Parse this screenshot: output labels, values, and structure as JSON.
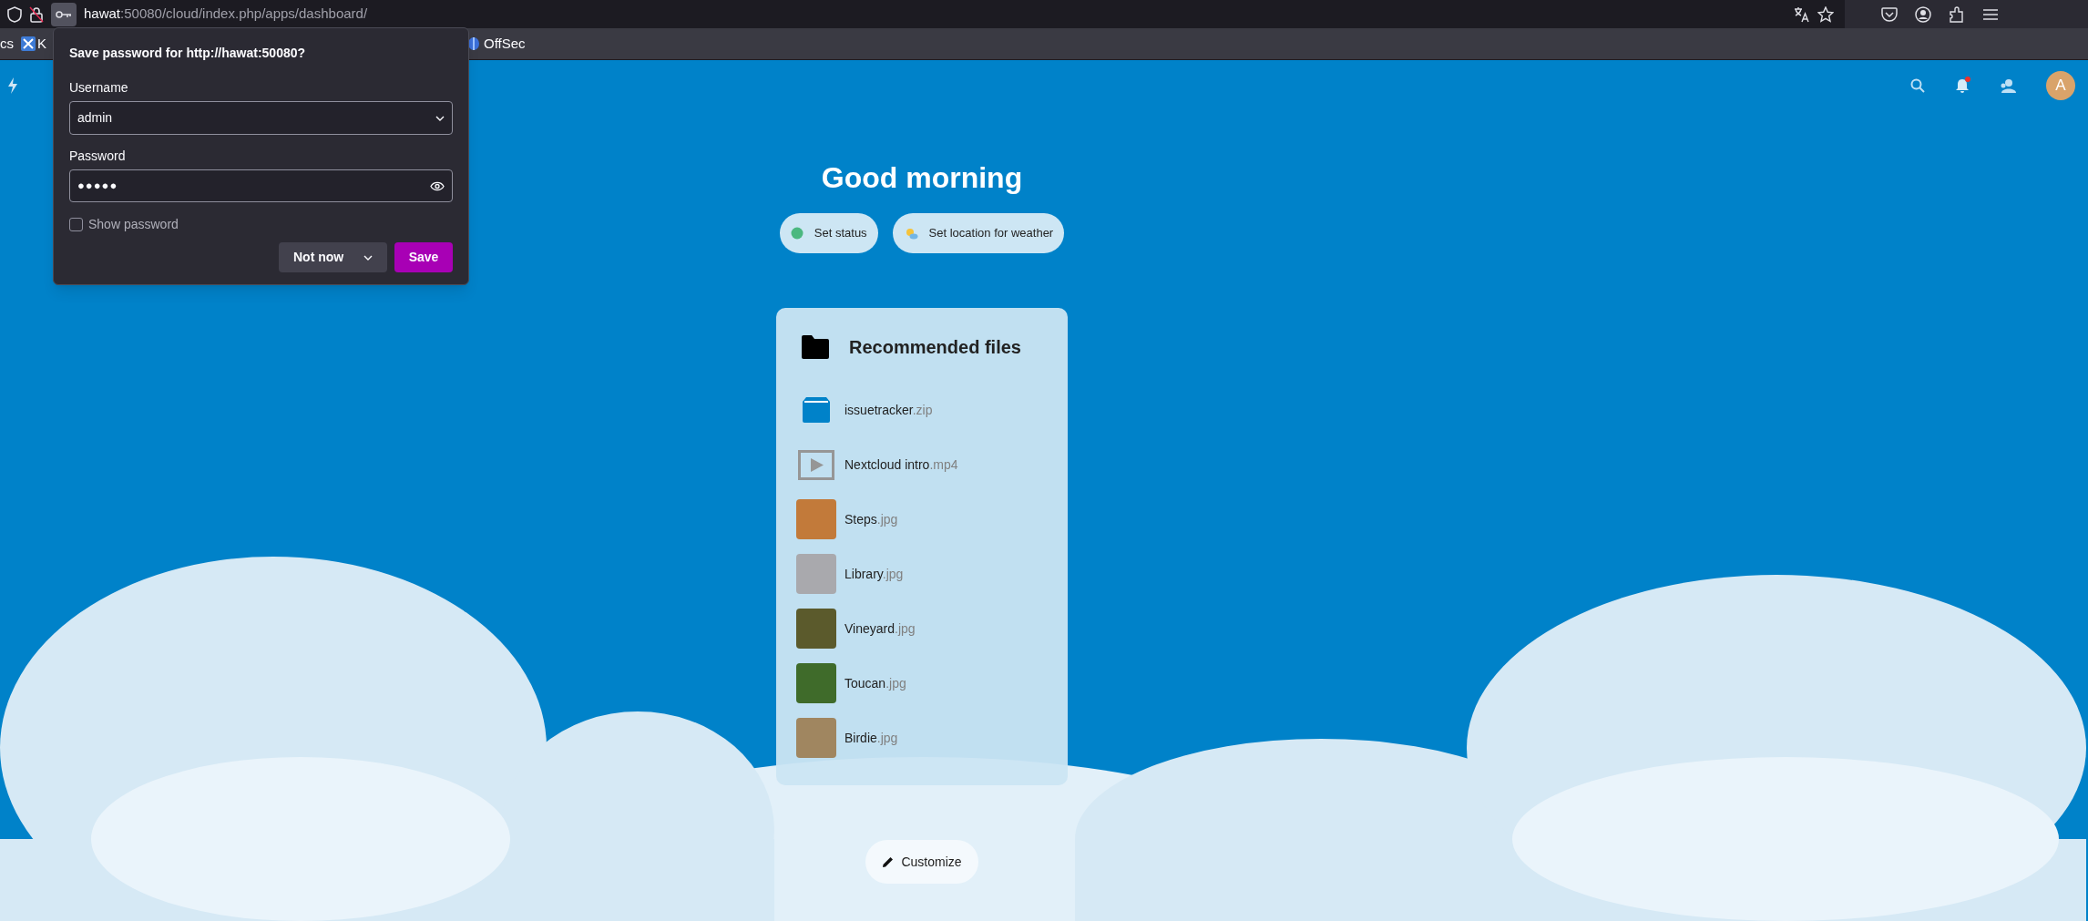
{
  "browser": {
    "url_host": "hawat",
    "url_rest": ":50080/cloud/index.php/apps/dashboard/",
    "bookmarks": [
      {
        "label": "cs",
        "kind": "plain"
      },
      {
        "label": "K",
        "kind": "tool"
      },
      {
        "label": "OffSec",
        "kind": "offsec"
      }
    ]
  },
  "password_popup": {
    "title": "Save password for http://hawat:50080?",
    "username_label": "Username",
    "username": "admin",
    "password_label": "Password",
    "password": "●●●●●",
    "show_password": {
      "label": "Show password",
      "checked": false
    },
    "not_now": "Not now",
    "save": "Save"
  },
  "header": {
    "avatar": "A",
    "notification": true
  },
  "greeting": "Good morning",
  "actions": [
    {
      "label": "Set status",
      "kind": "status"
    },
    {
      "label": "Set location for weather",
      "kind": "weather"
    }
  ],
  "recommended": {
    "title": "Recommended files",
    "files": [
      {
        "name": "issuetracker",
        "ext": ".zip",
        "kind": "archive"
      },
      {
        "name": "Nextcloud intro",
        "ext": ".mp4",
        "kind": "video"
      },
      {
        "name": "Steps",
        "ext": ".jpg",
        "kind": "image"
      },
      {
        "name": "Library",
        "ext": ".jpg",
        "kind": "image"
      },
      {
        "name": "Vineyard",
        "ext": ".jpg",
        "kind": "image"
      },
      {
        "name": "Toucan",
        "ext": ".jpg",
        "kind": "image"
      },
      {
        "name": "Birdie",
        "ext": ".jpg",
        "kind": "image"
      }
    ]
  },
  "customize": "Customize"
}
